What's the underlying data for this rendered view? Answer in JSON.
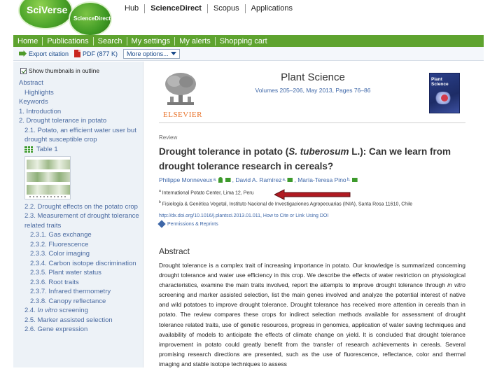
{
  "brand": {
    "sciverse_logo": "SciVerse",
    "sciencedirect_logo": "ScienceDirect"
  },
  "top_nav": [
    "Hub",
    "ScienceDirect",
    "Scopus",
    "Applications"
  ],
  "green_nav": [
    "Home",
    "Publications",
    "Search",
    "My settings",
    "My alerts",
    "Shopping cart"
  ],
  "toolbar": {
    "export_label": "Export citation",
    "pdf_label": "PDF (877 K)",
    "more_options": "More options..."
  },
  "sidebar": {
    "thumbnails_label": "Show thumbnails in outline",
    "thumbnails_checked": true,
    "outline": [
      {
        "label": "Abstract",
        "level": 1
      },
      {
        "label": "Highlights",
        "level": 2
      },
      {
        "label": "Keywords",
        "level": 1
      },
      {
        "label": "1. Introduction",
        "level": 1
      },
      {
        "label": "2. Drought tolerance in potato",
        "level": 1
      },
      {
        "label": "2.1. Potato, an efficient water user but drought susceptible crop",
        "level": 2
      }
    ],
    "table_label": "Table 1",
    "outline2": [
      {
        "label": "2.2. Drought effects on the potato crop",
        "level": 2
      },
      {
        "label": "2.3. Measurement of drought tolerance related traits",
        "level": 2
      },
      {
        "label": "2.3.1. Gas exchange",
        "level": 3
      },
      {
        "label": "2.3.2. Fluorescence",
        "level": 3
      },
      {
        "label": "2.3.3. Color imaging",
        "level": 3
      },
      {
        "label": "2.3.4. Carbon isotope discrimination",
        "level": 3
      },
      {
        "label": "2.3.5. Plant water status",
        "level": 3
      },
      {
        "label": "2.3.6. Root traits",
        "level": 3
      },
      {
        "label": "2.3.7. Infrared thermometry",
        "level": 3
      },
      {
        "label": "2.3.8. Canopy reflectance",
        "level": 3
      },
      {
        "label_prefix": "2.4. ",
        "label_em": "In vitro",
        "label_suffix": " screening",
        "level": 2
      },
      {
        "label": "2.5. Marker assisted selection",
        "level": 2
      },
      {
        "label": "2.6. Gene expression",
        "level": 2
      }
    ]
  },
  "journal": {
    "publisher": "ELSEVIER",
    "title": "Plant Science",
    "volume_line": "Volumes 205–206, May 2013, Pages 76–86",
    "cover_text": "Plant Science"
  },
  "article": {
    "type": "Review",
    "title_part1": "Drought tolerance in potato (",
    "title_em": "S. tuberosum",
    "title_part2": " L.): Can we learn from drought tolerance research in cereals?",
    "authors": [
      {
        "name": "Philippe Monneveux",
        "sup": "a,"
      },
      {
        "name": "David A. Ramírez",
        "sup": "a,"
      },
      {
        "name": "María-Teresa Pino",
        "sup": "b,"
      }
    ],
    "affiliations": [
      {
        "mark": "a",
        "text": "International Potato Center, Lima 12, Peru"
      },
      {
        "mark": "b",
        "text": "Fisiología & Genética Vegetal, Instituto Nacional de Investigaciones Agropecuarias (INIA), Santa Rosa 11610, Chile"
      }
    ],
    "doi_line": "http://dx.doi.org/10.1016/j.plantsci.2013.01.011, How to Cite or Link Using DOI",
    "permissions": "Permissions & Reprints",
    "abstract_heading": "Abstract",
    "abstract_part1": "Drought tolerance is a complex trait of increasing importance in potato. Our knowledge is summarized concerning drought tolerance and water use efficiency in this crop. We describe the effects of water restriction on physiological characteristics, examine the main traits involved, report the attempts to improve drought tolerance through ",
    "abstract_em": "in vitro",
    "abstract_part2": " screening and marker assisted selection, list the main genes involved and analyze the potential interest of native and wild potatoes to improve drought tolerance. Drought tolerance has received more attention in cereals than in potato. The review compares these crops for indirect selection methods available for assessment of drought tolerance related traits, use of genetic resources, progress in genomics, application of water saving techniques and availability of models to anticipate the effects of climate change on yield. It is concluded that drought tolerance improvement in potato could greatly benefit from the transfer of research achievements in cereals. Several promising research directions are presented, such as the use of fluorescence, reflectance, color and thermal imaging and stable isotope techniques to assess"
  },
  "colors": {
    "nav_green": "#5ea32f",
    "link_blue": "#3e67a8",
    "arrow_red": "#b01a22",
    "publisher_orange": "#e8722a"
  }
}
